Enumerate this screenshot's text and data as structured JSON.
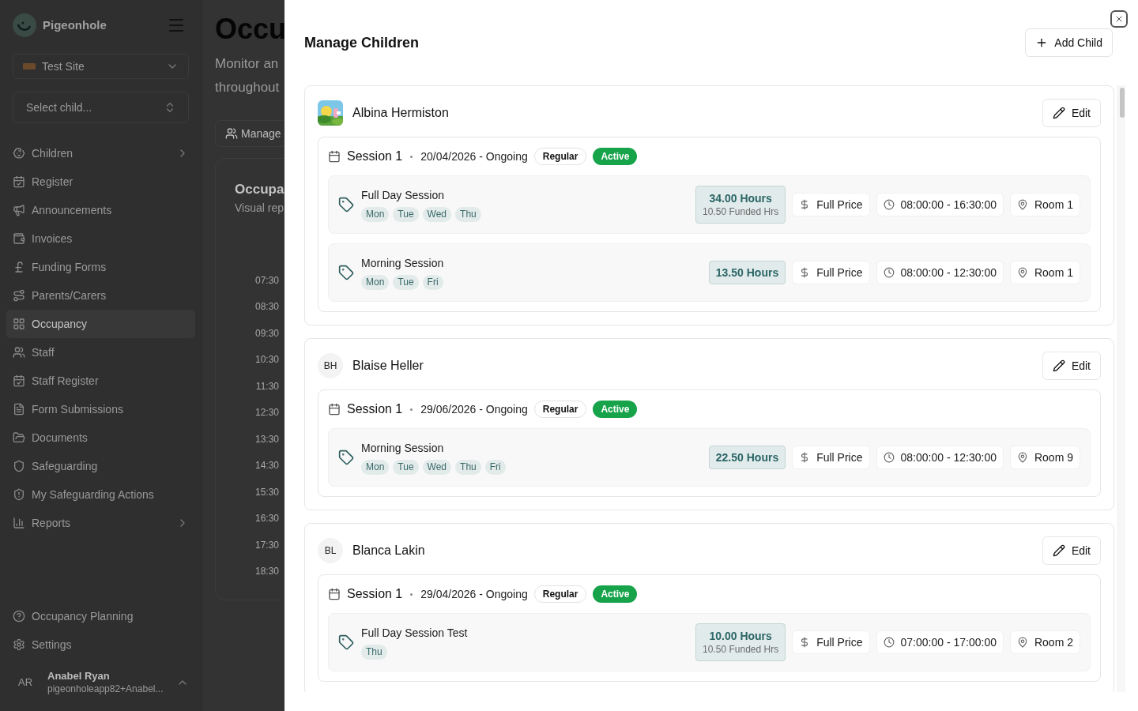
{
  "sidebar": {
    "brand": "Pigeonhole",
    "site_select": "Test Site",
    "child_select": {
      "placeholder": "Select child..."
    },
    "nav_items": [
      {
        "label": "Children",
        "has_submenu": true,
        "selected": false
      },
      {
        "label": "Register",
        "has_submenu": false,
        "selected": false
      },
      {
        "label": "Announcements",
        "has_submenu": false,
        "selected": false
      },
      {
        "label": "Invoices",
        "has_submenu": false,
        "selected": false
      },
      {
        "label": "Funding Forms",
        "has_submenu": false,
        "selected": false
      },
      {
        "label": "Parents/Carers",
        "has_submenu": false,
        "selected": false
      },
      {
        "label": "Occupancy",
        "has_submenu": false,
        "selected": true
      },
      {
        "label": "Staff",
        "has_submenu": false,
        "selected": false
      },
      {
        "label": "Staff Register",
        "has_submenu": false,
        "selected": false
      },
      {
        "label": "Form Submissions",
        "has_submenu": false,
        "selected": false
      },
      {
        "label": "Documents",
        "has_submenu": false,
        "selected": false
      },
      {
        "label": "Safeguarding",
        "has_submenu": false,
        "selected": false
      },
      {
        "label": "My Safeguarding Actions",
        "has_submenu": false,
        "selected": false
      },
      {
        "label": "Reports",
        "has_submenu": true,
        "selected": false
      }
    ],
    "footer_items": [
      {
        "label": "Occupancy Planning"
      },
      {
        "label": "Settings"
      }
    ],
    "user": {
      "initials": "AR",
      "name": "Anabel Ryan",
      "email": "pigeonholeapp82+Anabel..."
    }
  },
  "main": {
    "title": "Occu",
    "subtitle": [
      "Monitor an",
      "throughout"
    ],
    "manage_button": "Manage",
    "card_title": "Occupa",
    "card_subtitle": "Visual rep",
    "time_labels": [
      "07:30",
      "08:30",
      "09:30",
      "10:30",
      "11:30",
      "12:30",
      "13:30",
      "14:30",
      "15:30",
      "16:30",
      "17:30",
      "18:30"
    ]
  },
  "modal": {
    "title": "Manage Children",
    "add_button": "Add Child",
    "children": [
      {
        "name": "Albina Hermiston",
        "edit_label": "Edit",
        "avatar": {
          "kind": "picture"
        },
        "sessions": [
          {
            "title": "Session 1",
            "dates": "20/04/2026 - Ongoing",
            "type": "Regular",
            "status": "Active",
            "items": [
              {
                "name": "Full Day Session",
                "days": [
                  "Mon",
                  "Tue",
                  "Wed",
                  "Thu"
                ],
                "hours": "34.00 Hours",
                "funded": "10.50 Funded Hrs",
                "price": "Full Price",
                "time": "08:00:00 - 16:30:00",
                "room": "Room 1"
              },
              {
                "name": "Morning Session",
                "days": [
                  "Mon",
                  "Tue",
                  "Fri"
                ],
                "hours": "13.50 Hours",
                "price": "Full Price",
                "time": "08:00:00 - 12:30:00",
                "room": "Room 1"
              }
            ]
          }
        ]
      },
      {
        "name": "Blaise Heller",
        "edit_label": "Edit",
        "avatar": {
          "kind": "initials",
          "initials": "BH"
        },
        "sessions": [
          {
            "title": "Session 1",
            "dates": "29/06/2026 - Ongoing",
            "type": "Regular",
            "status": "Active",
            "items": [
              {
                "name": "Morning Session",
                "days": [
                  "Mon",
                  "Tue",
                  "Wed",
                  "Thu",
                  "Fri"
                ],
                "hours": "22.50 Hours",
                "price": "Full Price",
                "time": "08:00:00 - 12:30:00",
                "room": "Room 9"
              }
            ]
          }
        ]
      },
      {
        "name": "Blanca Lakin",
        "edit_label": "Edit",
        "avatar": {
          "kind": "initials",
          "initials": "BL"
        },
        "sessions": [
          {
            "title": "Session 1",
            "dates": "29/04/2026 - Ongoing",
            "type": "Regular",
            "status": "Active",
            "items": [
              {
                "name": "Full Day Session Test",
                "days": [
                  "Thu"
                ],
                "hours": "10.00 Hours",
                "funded": "10.50 Funded Hrs",
                "price": "Full Price",
                "time": "07:00:00 - 17:00:00",
                "room": "Room 2"
              }
            ]
          }
        ]
      }
    ]
  }
}
